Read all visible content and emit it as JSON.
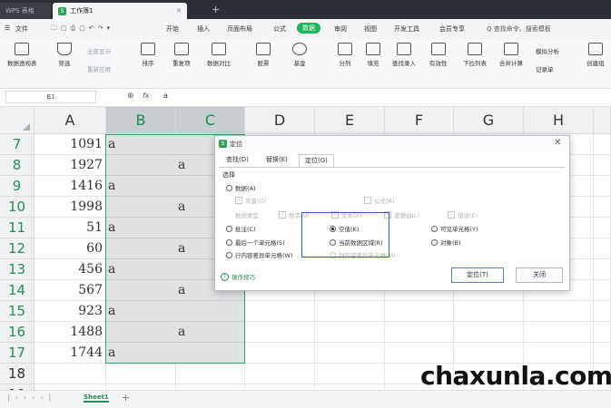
{
  "titlebar": {
    "app_label": "WPS 表格",
    "doc_label": "工作簿1",
    "new_tab": "+"
  },
  "menu": {
    "file": "文件",
    "items": [
      "开始",
      "插入",
      "页面布局",
      "公式",
      "数据",
      "审阅",
      "视图",
      "开发工具",
      "会员专享"
    ],
    "active": "数据",
    "search": "Q 查找命令、搜索模板"
  },
  "ribbon": {
    "buttons": [
      "数据透视表",
      "筛选",
      "排序",
      "重复项",
      "数据对比",
      "股票",
      "基金",
      "分列",
      "填充",
      "查找录入",
      "有效性",
      "下拉列表",
      "合并计算",
      "创建组"
    ],
    "small": [
      "全部显示",
      "重新应用",
      "模拟分析",
      "记录单"
    ]
  },
  "formula_bar": {
    "name_box": "B1",
    "fx": "fx"
  },
  "columns": [
    "A",
    "B",
    "C",
    "D",
    "E",
    "F",
    "G",
    "H"
  ],
  "rows": [
    {
      "n": "7",
      "a": "1091",
      "b": "a",
      "c": ""
    },
    {
      "n": "8",
      "a": "1927",
      "b": "",
      "c": "a"
    },
    {
      "n": "9",
      "a": "1416",
      "b": "a",
      "c": ""
    },
    {
      "n": "10",
      "a": "1998",
      "b": "",
      "c": "a"
    },
    {
      "n": "11",
      "a": "51",
      "b": "a",
      "c": ""
    },
    {
      "n": "12",
      "a": "60",
      "b": "",
      "c": "a"
    },
    {
      "n": "13",
      "a": "456",
      "b": "a",
      "c": ""
    },
    {
      "n": "14",
      "a": "567",
      "b": "",
      "c": "a"
    },
    {
      "n": "15",
      "a": "923",
      "b": "a",
      "c": ""
    },
    {
      "n": "16",
      "a": "1488",
      "b": "",
      "c": "a"
    },
    {
      "n": "17",
      "a": "1744",
      "b": "a",
      "c": ""
    },
    {
      "n": "18",
      "a": "",
      "b": "",
      "c": ""
    },
    {
      "n": "19",
      "a": "",
      "b": "",
      "c": ""
    }
  ],
  "sheet_tab": "Sheet1",
  "dialog": {
    "title": "定位",
    "tabs": [
      "查找(D)",
      "替换(E)",
      "定位(G)"
    ],
    "group": "选择",
    "options": {
      "data": "数据(A)",
      "constant": "常量(O)",
      "formula": "公式(R)",
      "number": "数字(U)",
      "text": "文本(X)",
      "logical": "逻辑值(L)",
      "error": "错误(E)",
      "data_type": "数据类型",
      "comments": "批注(C)",
      "blank": "空值(K)",
      "visible": "可见单元格(Y)",
      "last_cell": "最后一个单元格(S)",
      "current_region": "当前数据区域(R)",
      "objects": "对象(B)",
      "row_diff": "行内容差异单元格(W)",
      "col_diff": "列内容差异单元格(M)"
    },
    "skills": "操作技巧",
    "ok": "定位(T)",
    "close": "关闭"
  },
  "watermark": "chaxunla.com"
}
